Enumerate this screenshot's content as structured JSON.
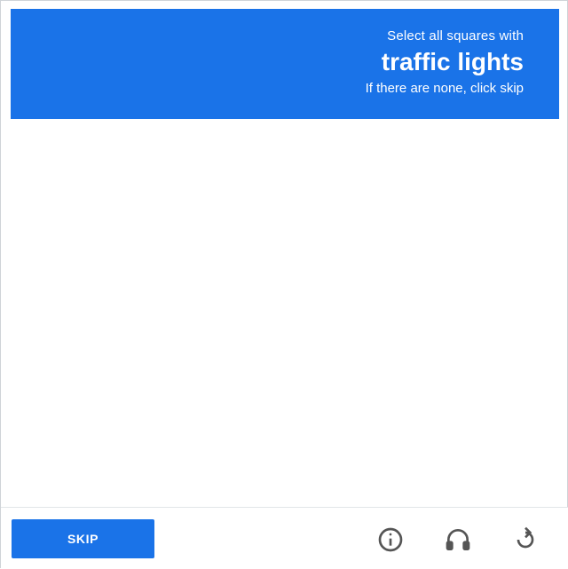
{
  "header": {
    "instruction": "Select all squares with",
    "target": "traffic lights",
    "hint": "If there are none, click skip"
  },
  "grid": {
    "rows": 4,
    "cols": 4
  },
  "footer": {
    "skip_label": "SKIP",
    "icons": [
      "info-icon",
      "headphones-icon",
      "reload-icon"
    ]
  },
  "colors": {
    "accent": "#1a73e8"
  }
}
